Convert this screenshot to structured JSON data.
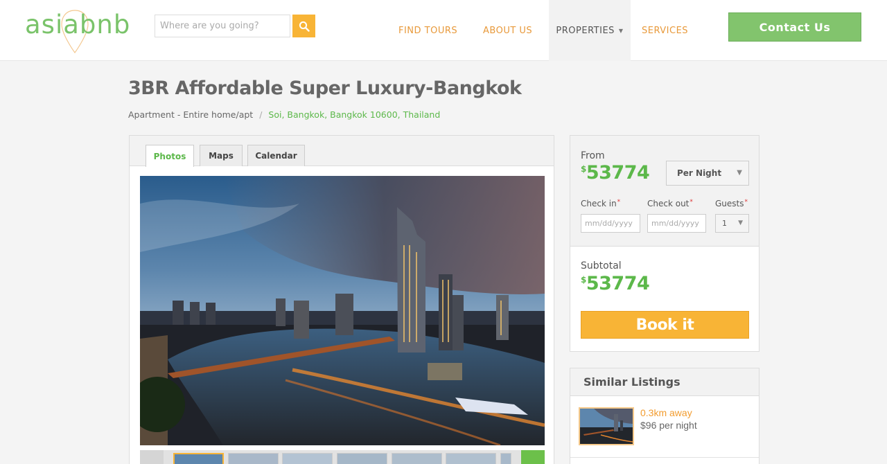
{
  "header": {
    "logo_text": "asiabnb",
    "search_placeholder": "Where are you going?",
    "nav": {
      "find_tours": "FIND TOURS",
      "about_us": "ABOUT US",
      "properties": "PROPERTIES",
      "services": "SERVICES"
    },
    "contact_label": "Contact Us"
  },
  "listing": {
    "title": "3BR Affordable Super Luxury-Bangkok",
    "type": "Apartment - Entire home/apt",
    "separator": "/",
    "location": "Soi, Bangkok, Bangkok 10600, Thailand"
  },
  "gallery": {
    "tabs": [
      "Photos",
      "Maps",
      "Calendar"
    ],
    "active_tab": "Photos",
    "thumbnail_count_visible": 7
  },
  "booking": {
    "from_label": "From",
    "currency_symbol": "$",
    "price": "53774",
    "rate_option": "Per Night",
    "checkin_label": "Check in",
    "checkout_label": "Check out",
    "guests_label": "Guests",
    "required_mark": "*",
    "date_placeholder": "mm/dd/yyyy",
    "guests_value": "1",
    "subtotal_label": "Subtotal",
    "subtotal_price": "53774",
    "book_label": "Book it"
  },
  "similar": {
    "heading": "Similar Listings",
    "items": [
      {
        "distance": "0.3km away",
        "price": "$96 per night"
      }
    ]
  },
  "colors": {
    "brand_green": "#7ac36a",
    "price_green": "#5cb84a",
    "accent_orange": "#f8b436",
    "nav_orange": "#e8993a"
  }
}
